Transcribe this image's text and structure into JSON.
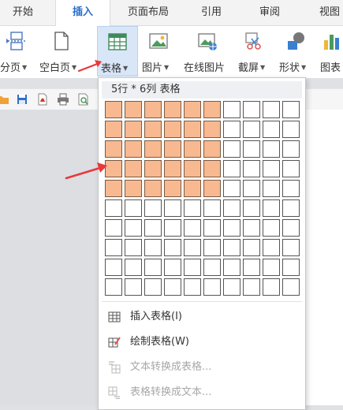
{
  "tabs": [
    {
      "label": "开始",
      "active": false
    },
    {
      "label": "插入",
      "active": true
    },
    {
      "label": "页面布局",
      "active": false
    },
    {
      "label": "引用",
      "active": false
    },
    {
      "label": "审阅",
      "active": false
    },
    {
      "label": "视图",
      "active": false
    }
  ],
  "ribbon": {
    "page_break": "分页",
    "blank_page": "空白页",
    "table": "表格",
    "picture": "图片",
    "online_picture": "在线图片",
    "screenshot": "截屏",
    "shape": "形状",
    "chart": "图表"
  },
  "table_menu": {
    "grid_caption": "5行 * 6列 表格",
    "grid": {
      "rows": 10,
      "cols": 10,
      "selected_rows": 5,
      "selected_cols": 6
    },
    "items": [
      {
        "label": "插入表格(I)",
        "enabled": true,
        "icon": "table-icon"
      },
      {
        "label": "绘制表格(W)",
        "enabled": true,
        "icon": "pencil-table-icon"
      },
      {
        "label": "文本转换成表格...",
        "enabled": false,
        "icon": "text-to-table-icon"
      },
      {
        "label": "表格转换成文本...",
        "enabled": false,
        "icon": "table-to-text-icon"
      }
    ]
  },
  "colors": {
    "accent": "#2a6fc9",
    "selected_cell": "#f8b990",
    "annotation_arrow": "#e8393b"
  }
}
